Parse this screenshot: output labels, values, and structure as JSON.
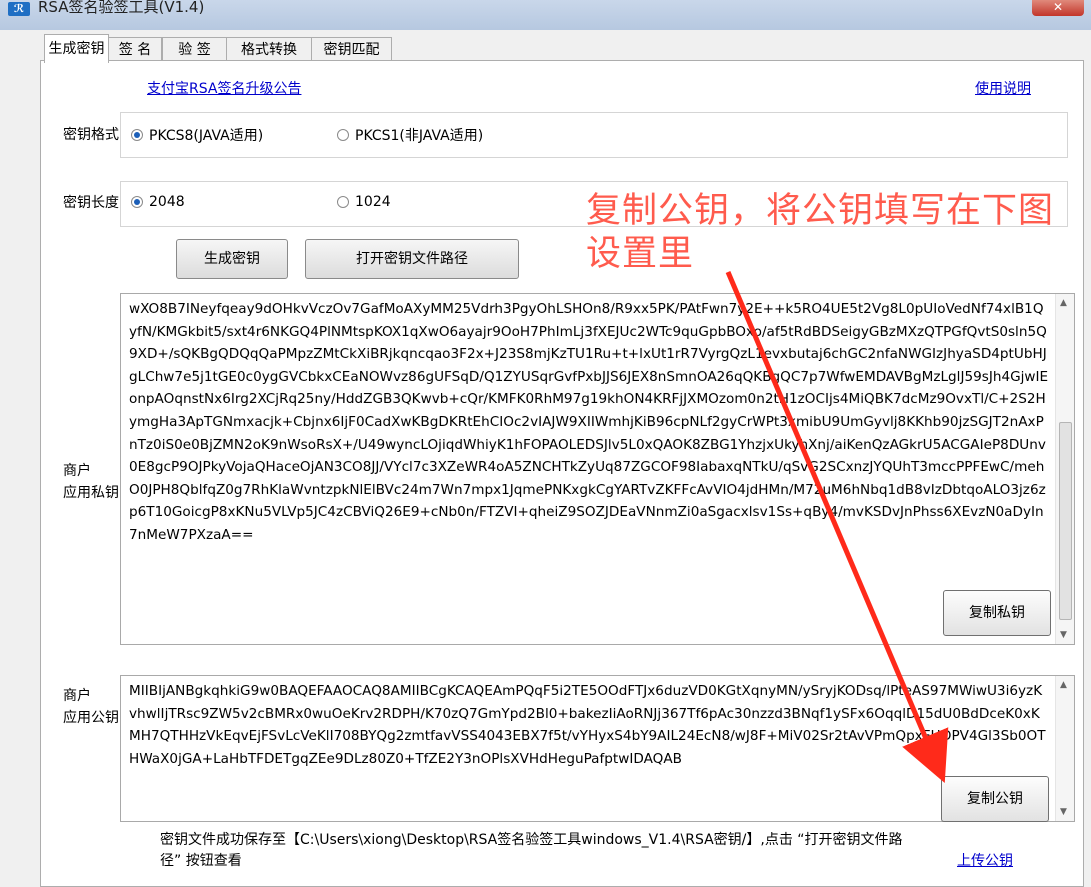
{
  "window": {
    "title": "RSA签名验签工具(V1.4)",
    "close": "✕"
  },
  "tabs": [
    "生成密钥",
    "签 名",
    "验 签",
    "格式转换",
    "密钥匹配"
  ],
  "links": {
    "announcement": "支付宝RSA签名升级公告",
    "manual": "使用说明",
    "upload_public_key": "上传公钥"
  },
  "key_format": {
    "label": "密钥格式：",
    "options": [
      "PKCS8(JAVA适用)",
      "PKCS1(非JAVA适用)"
    ],
    "selected": "PKCS8(JAVA适用)"
  },
  "key_length": {
    "label": "密钥长度：",
    "options": [
      "2048",
      "1024"
    ],
    "selected": "2048"
  },
  "buttons": {
    "generate": "生成密钥",
    "open_path": "打开密钥文件路径",
    "copy_private": "复制私钥",
    "copy_public": "复制公钥"
  },
  "private_key": {
    "label_line1": "商户",
    "label_line2": "应用私钥：",
    "value": "wXO8B7INeyfqeay9dOHkvVczOv7GafMoAXyMM25Vdrh3PgyOhLSHOn8/R9xx5PK/PAtFwn7y2E++k5RO4UE5t2Vg8L0pUIoVedNf74xlB1QyfN/KMGkbit5/sxt4r6NKGQ4PlNMtspKOX1qXwO6ayajr9OoH7PhImLj3fXEJUc2WTc9quGpbBOxo/af5tRdBDSeigyGBzMXzQTPGfQvtS0sln5Q9XD+/sQKBgQDQqQaPMpzZMtCkXiBRjkqncqao3F2x+J23S8mjKzTU1Ru+t+lxUt1rR7VyrgQzL1evxbutaj6chGC2nfaNWGIzJhyaSD4ptUbHJgLChw7e5j1tGE0c0ygGVCbkxCEaNOWvz86gUFSqD/Q1ZYUSqrGvfPxbJJS6JEX8nSmnOA26qQKBgQC7p7WfwEMDAVBgMzLglJ59sJh4GjwIEonpAOqnstNx6Irg2XCjRq25ny/HddZGB3QKwvb+cQr/KMFK0RhM97g19khON4KRFjJXMOzom0n2tH1zOCIjs4MiQBK7dcMz9OvxTl/C+2S2HymgHa3ApTGNmxacjk+Cbjnx6IjF0CadXwKBgDKRtEhCIOc2vIAJW9XIIWmhjKiB96cpNLf2gyCrWPt3xmibU9UmGyvlj8KKhb90jzSGJT2nAxPnTz0iS0e0BjZMN2oK9nWsoRsX+/U49wyncLOjiqdWhiyK1hFOPAOLEDSJlv5L0xQAOK8ZBG1YhzjxUkyhXnj/aiKenQzAGkrU5ACGAIeP8DUnv0E8gcP9OJPkyVojaQHaceOjAN3CO8JJ/VYcl7c3XZeWR4oA5ZNCHTkZyUq87ZGCOF98IabaxqNTkU/qSvG2SCxnzJYQUhT3mccPPFEwC/mehO0JPH8QblfqZ0g7RhKlaWvntzpkNlElBVc24m7Wn7mpx1JqmePNKxgkCgYARTvZKFFcAvVIO4jdHMn/M72uM6hNbq1dB8vIzDbtqoALO3jz6zp6T10GoicgP8xKNu5VLVp5JC4zCBViQ26E9+cNb0n/FTZVI+qheiZ9SOZJDEaVNnmZi0aSgacxlsv1Ss+qBy4/mvKSDvJnPhss6XEvzN0aDyIn7nMeW7PXzaA=="
  },
  "public_key": {
    "label_line1": "商户",
    "label_line2": "应用公钥：",
    "value": "MIIBIjANBgkqhkiG9w0BAQEFAAOCAQ8AMIIBCgKCAQEAmPQqF5i2TE5OOdFTJx6duzVD0KGtXqnyMN/ySryjKODsq/lPteAS97MWiwU3i6yzKvhwlIjTRsc9ZW5v2cBMRx0wuOeKrv2RDPH/K70zQ7GmYpd2Bl0+bakezIiAoRNJj367Tf6pAc30nzzd3BNqf1ySFx6OqqlD15dU0BdDceK0xKMH7QTHHzVkEqvEjFSvLcVeKlI708BYQg2zmtfavVSS4043EBX7f5t/vYHyxS4bY9AIL24EcN8/wJ8F+MiV02Sr2tAvVPmQpxFHOPV4Gl3Sb0OTHWaX0jGA+LaHbTFDETgqZEe9DLz80Z0+TfZE2Y3nOPlsXVHdHeguPafptwIDAQAB"
  },
  "annotation": {
    "line1": "复制公钥，将公钥填写在下图",
    "line2": "设置里"
  },
  "status": {
    "text": "密钥文件成功保存至【C:\\Users\\xiong\\Desktop\\RSA签名验签工具windows_V1.4\\RSA密钥/】,点击 “打开密钥文件路径” 按钮查看"
  },
  "colors": {
    "annotation_red": "#ff5b4d",
    "link_blue": "#0000cc",
    "arrow_red": "#ff2a1a"
  }
}
